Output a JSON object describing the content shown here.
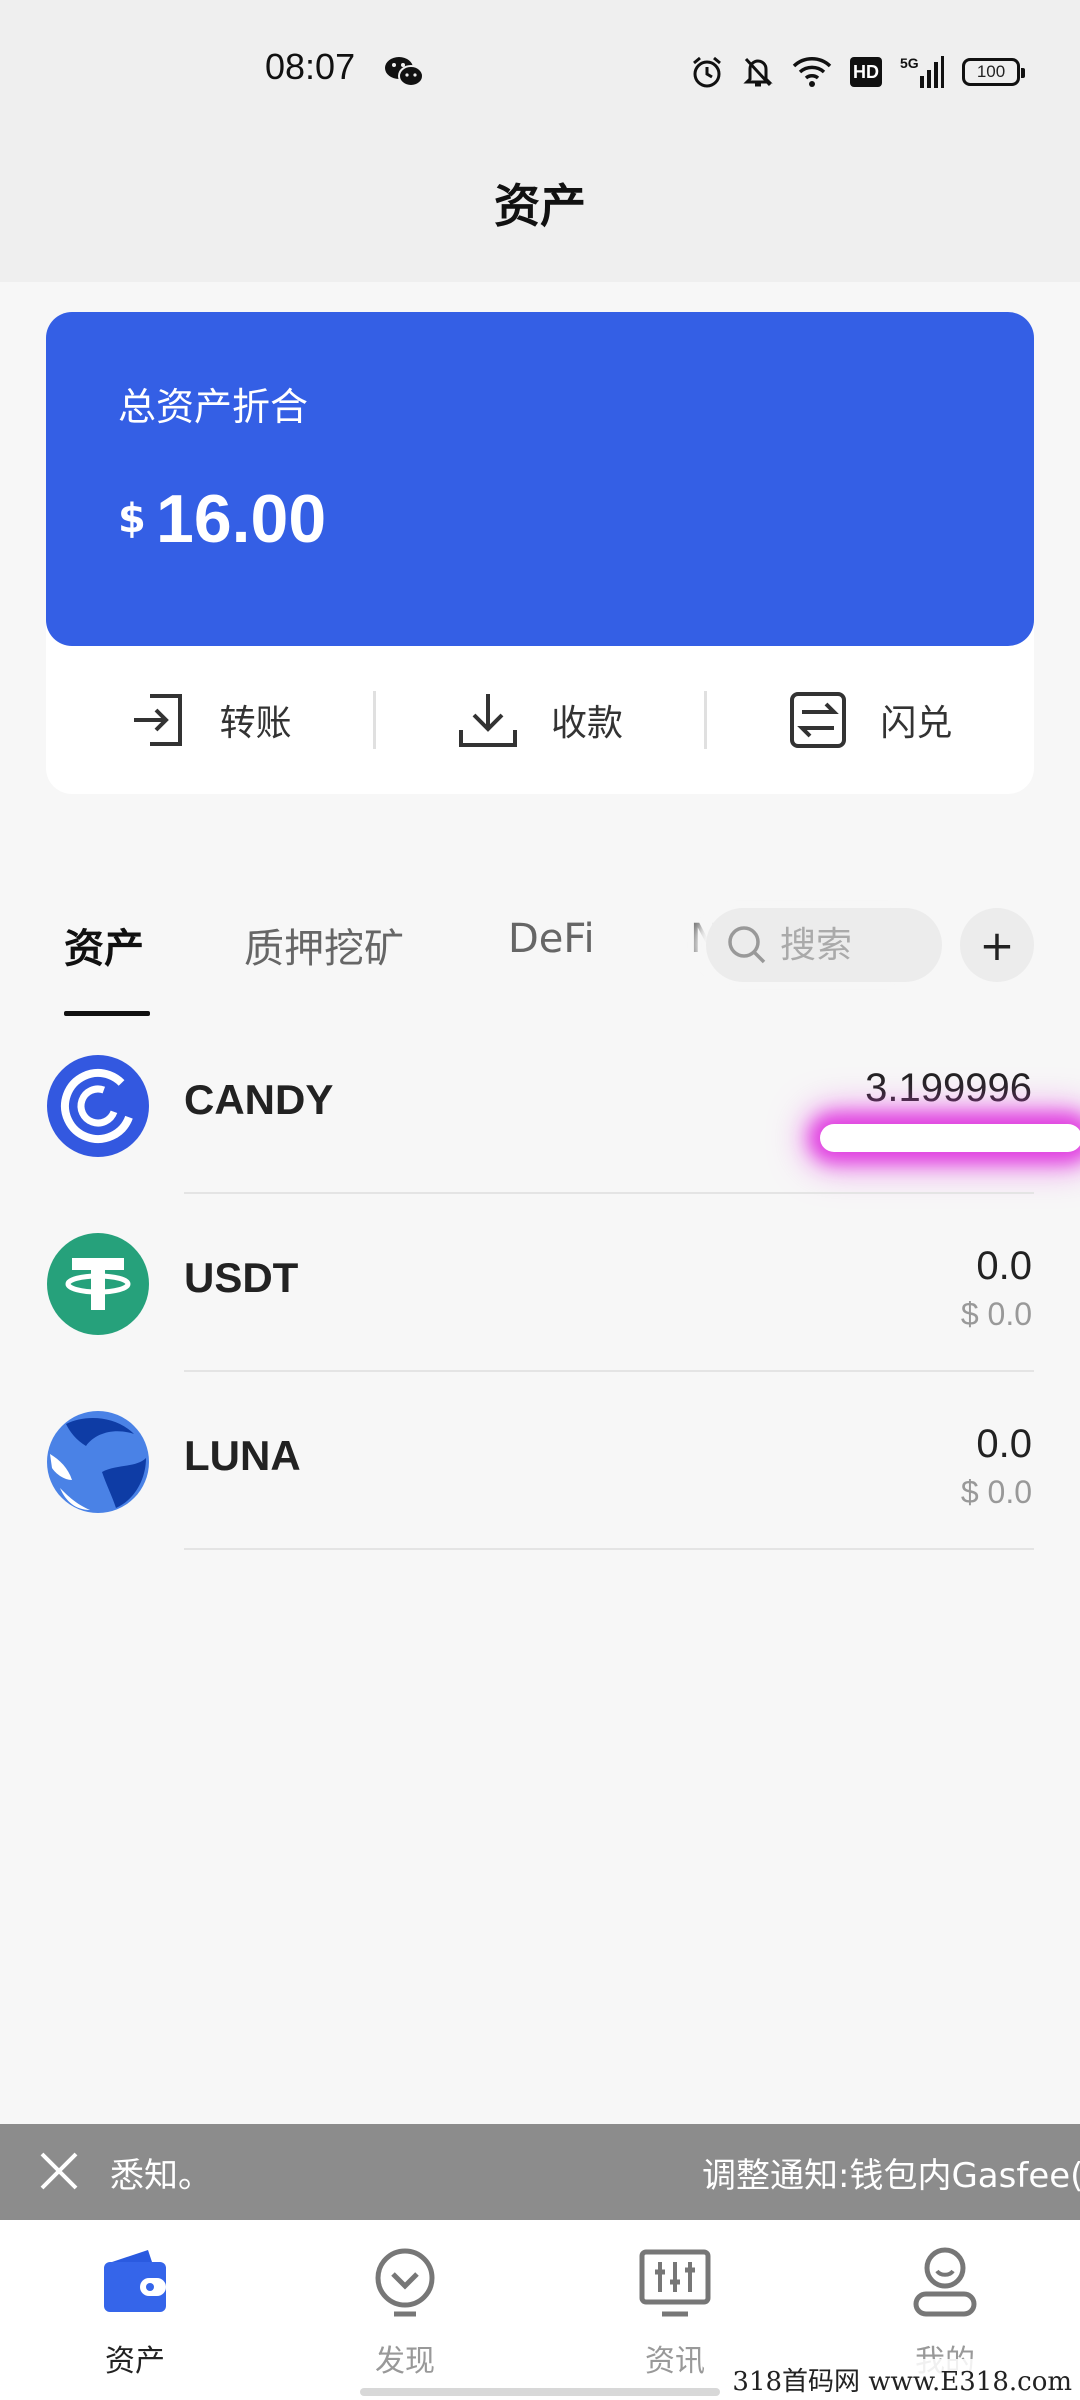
{
  "status_bar": {
    "time": "08:07",
    "network": "5G",
    "hd": "HD",
    "battery": "100",
    "icons": [
      "wechat-icon",
      "alarm-icon",
      "mute-icon",
      "wifi-icon",
      "hd-badge",
      "signal-icon",
      "battery-icon"
    ]
  },
  "header": {
    "title": "资产"
  },
  "balance": {
    "label": "总资产折合",
    "currency": "$",
    "value": "16.00",
    "card_color": "#345fe5"
  },
  "actions": [
    {
      "label": "转账",
      "icon": "transfer-icon"
    },
    {
      "label": "收款",
      "icon": "receive-icon"
    },
    {
      "label": "闪兑",
      "icon": "swap-icon"
    }
  ],
  "tabs": [
    {
      "label": "资产",
      "active": true
    },
    {
      "label": "质押挖矿",
      "active": false
    },
    {
      "label": "DeFi",
      "active": false
    },
    {
      "label": "N",
      "active": false
    }
  ],
  "search": {
    "placeholder": "搜索"
  },
  "add_button": "+",
  "tokens": [
    {
      "symbol": "CANDY",
      "amount": "3.199996",
      "fiat": "",
      "color": "#3358e0"
    },
    {
      "symbol": "USDT",
      "amount": "0.0",
      "fiat": "$ 0.0",
      "color": "#26a17b"
    },
    {
      "symbol": "LUNA",
      "amount": "0.0",
      "fiat": "$ 0.0",
      "color": "#4a82e6"
    }
  ],
  "notice": {
    "text_left": "悉知。",
    "text_right": "调整通知:钱包内Gasfee(燃"
  },
  "nav": [
    {
      "label": "资产",
      "icon": "wallet-icon",
      "active": true
    },
    {
      "label": "发现",
      "icon": "discover-icon",
      "active": false
    },
    {
      "label": "资讯",
      "icon": "news-icon",
      "active": false
    },
    {
      "label": "我的",
      "icon": "profile-icon",
      "active": false
    }
  ],
  "watermark": "318首码网 www.E318.com"
}
